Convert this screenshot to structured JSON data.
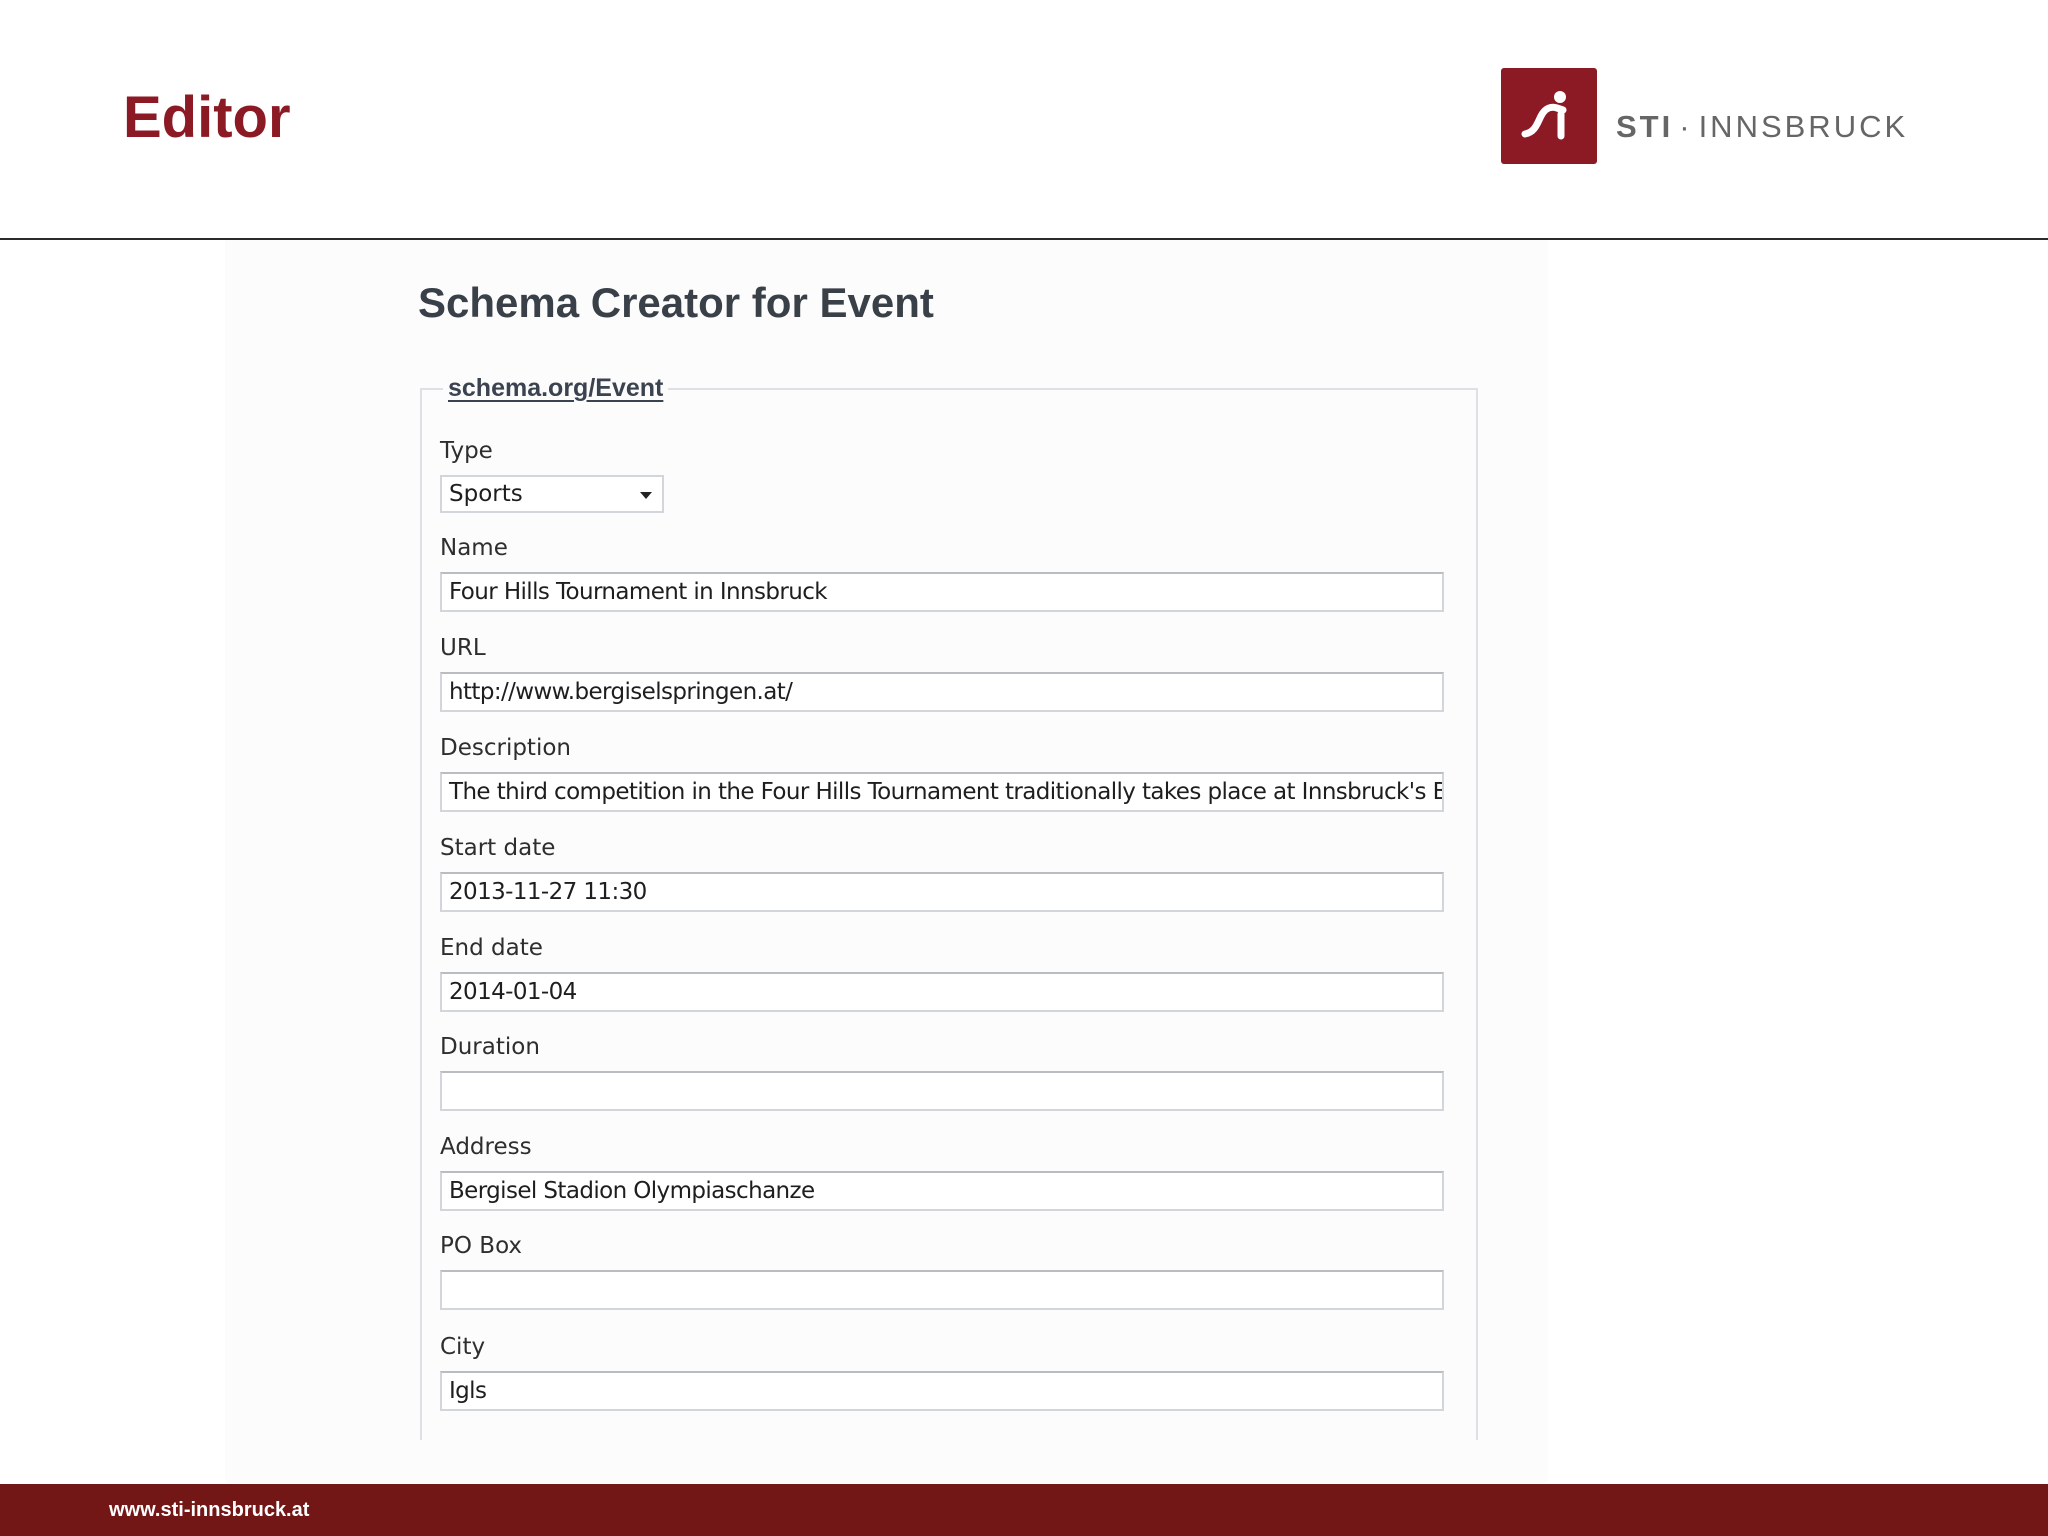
{
  "slide": {
    "title": "Editor",
    "footer_url": "www.sti-innsbruck.at"
  },
  "logo": {
    "text_bold": "STI",
    "text_sep": "·",
    "text_rest": "INNSBRUCK",
    "brand_color": "#8c1a24"
  },
  "form": {
    "heading": "Schema Creator for Event",
    "legend": "schema.org/Event",
    "type": {
      "label": "Type",
      "selected": "Sports"
    },
    "fields": {
      "name": {
        "label": "Name",
        "value": "Four Hills Tournament in Innsbruck"
      },
      "url": {
        "label": "URL",
        "value": "http://www.bergiselspringen.at/"
      },
      "description": {
        "label": "Description",
        "value": "The third competition in the Four Hills Tournament traditionally takes place at Innsbruck's B"
      },
      "start_date": {
        "label": "Start date",
        "value": "2013-11-27 11:30"
      },
      "end_date": {
        "label": "End date",
        "value": "2014-01-04"
      },
      "duration": {
        "label": "Duration",
        "value": ""
      },
      "address": {
        "label": "Address",
        "value": "Bergisel Stadion Olympiaschanze"
      },
      "po_box": {
        "label": "PO Box",
        "value": ""
      },
      "city": {
        "label": "City",
        "value": "Igls"
      }
    }
  },
  "colors": {
    "title_red": "#8c1a24",
    "footer_red": "#731616"
  }
}
